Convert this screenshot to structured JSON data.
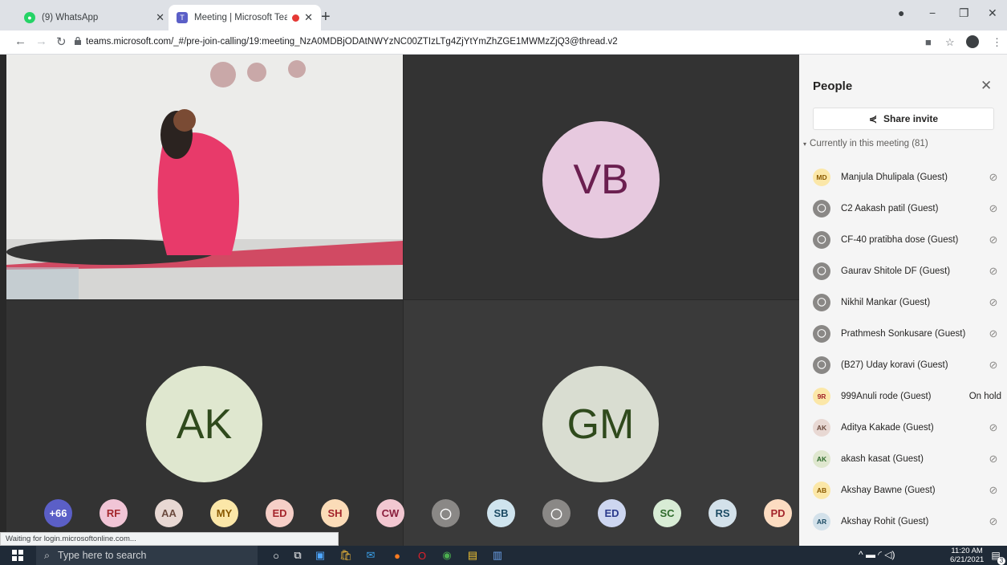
{
  "browser": {
    "tabs": [
      {
        "title": "(9) WhatsApp",
        "favicon": "whatsapp-icon"
      },
      {
        "title": "Meeting | Microsoft Teams",
        "favicon": "teams-icon"
      }
    ],
    "url": "teams.microsoft.com/_#/pre-join-calling/19:meeting_NzA0MDBjODAtNWYzNC00ZTIzLTg4ZjYtYmZhZGE1MWMzZjQ3@thread.v2",
    "status": "Waiting for login.microsoftonline.com..."
  },
  "stage": {
    "tiles": [
      {
        "initials": "VB",
        "color": "#e7c9df"
      },
      {
        "initials": "AK",
        "color": "#dfe7cf"
      },
      {
        "initials": "GM",
        "color": "#d9ddd1"
      }
    ],
    "strip": [
      {
        "label": "+66",
        "bg": "#5b5fc7",
        "fg": "#ffffff"
      },
      {
        "label": "RF",
        "bg": "#f1c5d6",
        "fg": "#a4262c"
      },
      {
        "label": "AA",
        "bg": "#e8d8d3",
        "fg": "#6b4a3e"
      },
      {
        "label": "MY",
        "bg": "#fbe7a8",
        "fg": "#8a5a00"
      },
      {
        "label": "ED",
        "bg": "#f6cfc7",
        "fg": "#a4262c"
      },
      {
        "label": "SH",
        "bg": "#fbdcb8",
        "fg": "#a4262c"
      },
      {
        "label": "CW",
        "bg": "#f2c7d1",
        "fg": "#8a1f3d"
      },
      {
        "label": "",
        "bg": "#8a8886",
        "fg": "#ffffff"
      },
      {
        "label": "SB",
        "bg": "#cfe4ee",
        "fg": "#1b4a63"
      },
      {
        "label": "",
        "bg": "#8a8886",
        "fg": "#ffffff"
      },
      {
        "label": "ED",
        "bg": "#cdd6f0",
        "fg": "#2b3a8c"
      },
      {
        "label": "SC",
        "bg": "#d8ecd5",
        "fg": "#2f6b2c"
      },
      {
        "label": "RS",
        "bg": "#d3e1ea",
        "fg": "#1b4a63"
      },
      {
        "label": "PD",
        "bg": "#fcdcc1",
        "fg": "#a4262c"
      }
    ]
  },
  "panel": {
    "title": "People",
    "share_label": "Share invite",
    "section": "Currently in this meeting (81)",
    "people": [
      {
        "initials": "MD",
        "bg": "#fbe7a8",
        "fg": "#8a5a00",
        "name": "Manjula Dhulipala (Guest)",
        "state": "muted"
      },
      {
        "initials": "",
        "bg": "#8a8886",
        "fg": "#ffffff",
        "name": "C2 Aakash patil (Guest)",
        "state": "muted"
      },
      {
        "initials": "",
        "bg": "#8a8886",
        "fg": "#ffffff",
        "name": "CF-40 pratibha dose (Guest)",
        "state": "muted"
      },
      {
        "initials": "",
        "bg": "#8a8886",
        "fg": "#ffffff",
        "name": "Gaurav Shitole DF (Guest)",
        "state": "muted"
      },
      {
        "initials": "",
        "bg": "#8a8886",
        "fg": "#ffffff",
        "name": "Nikhil Mankar (Guest)",
        "state": "muted"
      },
      {
        "initials": "",
        "bg": "#8a8886",
        "fg": "#ffffff",
        "name": "Prathmesh Sonkusare (Guest)",
        "state": "muted"
      },
      {
        "initials": "",
        "bg": "#8a8886",
        "fg": "#ffffff",
        "name": "(B27) Uday koravi (Guest)",
        "state": "muted"
      },
      {
        "initials": "9R",
        "bg": "#fbe7a8",
        "fg": "#a4262c",
        "name": "999Anuli rode (Guest)",
        "state": "On hold"
      },
      {
        "initials": "AK",
        "bg": "#e8d8d3",
        "fg": "#6b4a3e",
        "name": "Aditya Kakade (Guest)",
        "state": "muted"
      },
      {
        "initials": "AK",
        "bg": "#dfe7cf",
        "fg": "#2f6b2c",
        "name": "akash kasat (Guest)",
        "state": "muted"
      },
      {
        "initials": "AB",
        "bg": "#fbe7a8",
        "fg": "#8a5a00",
        "name": "Akshay Bawne (Guest)",
        "state": "muted"
      },
      {
        "initials": "AR",
        "bg": "#d3e1ea",
        "fg": "#1b4a63",
        "name": "Akshay Rohit (Guest)",
        "state": "muted"
      }
    ]
  },
  "taskbar": {
    "search_placeholder": "Type here to search",
    "time": "11:20 AM",
    "date": "6/21/2021",
    "notification_count": "3"
  }
}
